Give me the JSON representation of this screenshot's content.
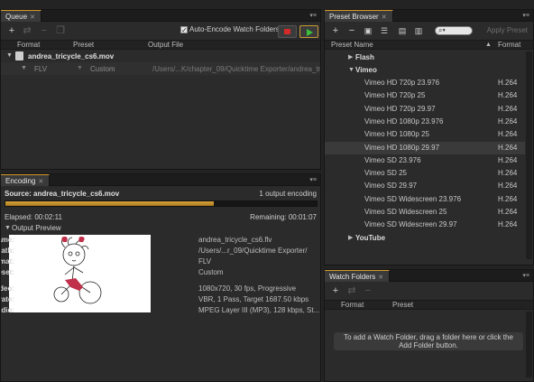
{
  "queue": {
    "tab_label": "Queue",
    "auto_encode_label": "Auto-Encode Watch Folders",
    "columns": [
      "Format",
      "Preset",
      "Output File"
    ],
    "item": {
      "name": "andrea_tricycle_cs6.mov"
    },
    "output": {
      "format": "FLV",
      "preset": "Custom",
      "path": "/Users/...K/chapter_09/Quicktime Exporter/andrea_tr"
    }
  },
  "encoding": {
    "tab_label": "Encoding",
    "source": "Source: andrea_tricycle_cs6.mov",
    "count": "1 output encoding",
    "elapsed": "Elapsed: 00:02:11",
    "remaining": "Remaining: 00:01:07",
    "progress": 0.67,
    "preview_label": "Output Preview",
    "meta": [
      {
        "k": "File Name:",
        "v": "andrea_tricycle_cs6.flv"
      },
      {
        "k": "Path:",
        "v": "/Users/...r_09/Quicktime Exporter/"
      },
      {
        "k": "Format:",
        "v": "FLV"
      },
      {
        "k": "Preset:",
        "v": "Custom"
      },
      {
        "k": "Video:",
        "v": "1080x720, 30 fps, Progressive"
      },
      {
        "k": "Bitrate:",
        "v": "VBR, 1 Pass, Target 1687.50 kbps"
      },
      {
        "k": "Audio:",
        "v": "MPEG Layer III (MP3), 128 kbps, St..."
      }
    ]
  },
  "preset_browser": {
    "tab_label": "Preset Browser",
    "apply_label": "Apply Preset",
    "columns": {
      "name": "Preset Name",
      "format": "Format"
    },
    "groups": [
      {
        "name": "Flash",
        "expanded": false
      },
      {
        "name": "Vimeo",
        "expanded": true
      },
      {
        "name": "YouTube",
        "expanded": false
      }
    ],
    "vimeo_presets": [
      {
        "name": "Vimeo HD 720p 23.976",
        "format": "H.264"
      },
      {
        "name": "Vimeo HD 720p 25",
        "format": "H.264"
      },
      {
        "name": "Vimeo HD 720p 29.97",
        "format": "H.264"
      },
      {
        "name": "Vimeo HD 1080p 23.976",
        "format": "H.264"
      },
      {
        "name": "Vimeo HD 1080p 25",
        "format": "H.264"
      },
      {
        "name": "Vimeo HD 1080p 29.97",
        "format": "H.264"
      },
      {
        "name": "Vimeo SD 23.976",
        "format": "H.264"
      },
      {
        "name": "Vimeo SD 25",
        "format": "H.264"
      },
      {
        "name": "Vimeo SD 29.97",
        "format": "H.264"
      },
      {
        "name": "Vimeo SD Widescreen 23.976",
        "format": "H.264"
      },
      {
        "name": "Vimeo SD Widescreen 25",
        "format": "H.264"
      },
      {
        "name": "Vimeo SD Widescreen 29.97",
        "format": "H.264"
      }
    ]
  },
  "watch_folders": {
    "tab_label": "Watch Folders",
    "columns": [
      "Format",
      "Preset"
    ],
    "info_line1": "To add a Watch Folder, drag a folder here or click the",
    "info_line2": "Add Folder button."
  },
  "colors": {
    "accent": "#d49a2c",
    "play": "#3bc13b",
    "stop": "#d42a2a"
  }
}
